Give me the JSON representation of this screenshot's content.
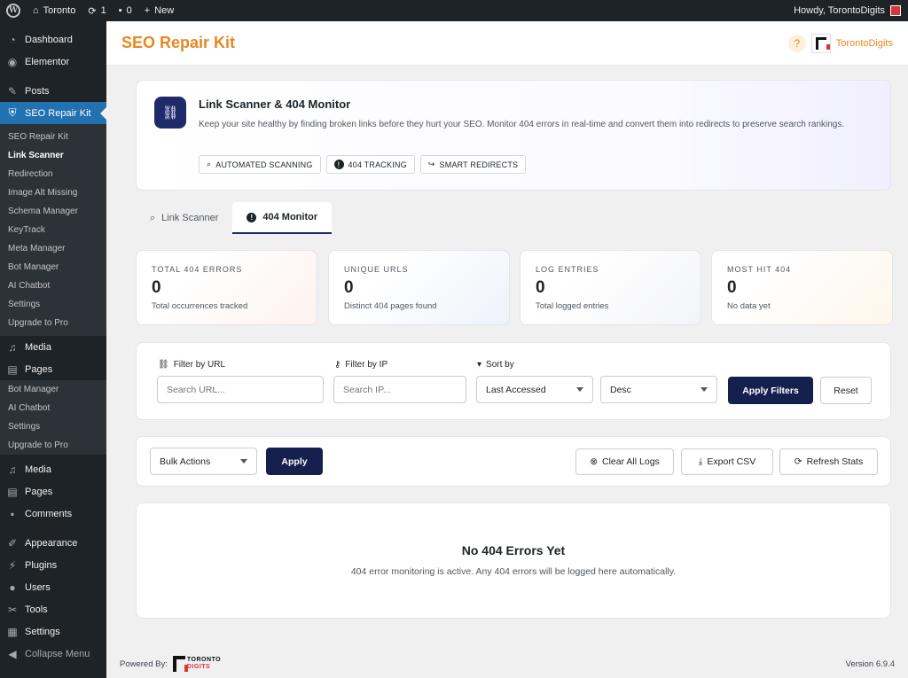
{
  "adminbar": {
    "wp_logo": "W",
    "site_name": "Toronto",
    "updates_count": "1",
    "comments_count": "0",
    "new_label": "New",
    "howdy": "Howdy, TorontoDigits"
  },
  "sidebar": {
    "top_items": [
      {
        "label": "Dashboard",
        "icon": "dashboard-icon"
      },
      {
        "label": "Elementor",
        "icon": "elementor-icon"
      },
      {
        "label": "Posts",
        "icon": "pin-icon"
      },
      {
        "label": "SEO Repair Kit",
        "icon": "shield-icon"
      }
    ],
    "submenu": [
      "SEO Repair Kit",
      "Link Scanner",
      "Redirection",
      "Image Alt Missing",
      "Schema Manager",
      "KeyTrack",
      "Meta Manager",
      "Bot Manager",
      "AI Chatbot",
      "Settings",
      "Upgrade to Pro"
    ],
    "mid_items": [
      {
        "label": "Media",
        "icon": "media-icon"
      },
      {
        "label": "Pages",
        "icon": "pages-icon"
      }
    ],
    "overlay_submenu": [
      "Bot Manager",
      "AI Chatbot",
      "Settings",
      "Upgrade to Pro"
    ],
    "bottom_items": [
      {
        "label": "Media",
        "icon": "media-icon"
      },
      {
        "label": "Pages",
        "icon": "pages-icon"
      },
      {
        "label": "Comments",
        "icon": "comments-icon"
      },
      {
        "label": "Appearance",
        "icon": "appearance-icon"
      },
      {
        "label": "Plugins",
        "icon": "plugins-icon"
      },
      {
        "label": "Users",
        "icon": "users-icon"
      },
      {
        "label": "Tools",
        "icon": "tools-icon"
      },
      {
        "label": "Settings",
        "icon": "settings-icon"
      }
    ],
    "collapse_label": "Collapse Menu"
  },
  "header": {
    "title": "SEO Repair Kit",
    "help": "?",
    "brand": "TorontoDigits"
  },
  "intro": {
    "title": "Link Scanner & 404 Monitor",
    "description": "Keep your site healthy by finding broken links before they hurt your SEO. Monitor 404 errors in real-time and convert them into redirects to preserve search rankings.",
    "chips": [
      "AUTOMATED SCANNING",
      "404 TRACKING",
      "SMART REDIRECTS"
    ]
  },
  "tabs": [
    {
      "label": "Link Scanner",
      "active": false
    },
    {
      "label": "404 Monitor",
      "active": true
    }
  ],
  "stats": [
    {
      "label": "TOTAL 404 ERRORS",
      "value": "0",
      "sub": "Total occurrences tracked"
    },
    {
      "label": "UNIQUE URLS",
      "value": "0",
      "sub": "Distinct 404 pages found"
    },
    {
      "label": "LOG ENTRIES",
      "value": "0",
      "sub": "Total logged entries"
    },
    {
      "label": "MOST HIT 404",
      "value": "0",
      "sub": "No data yet"
    }
  ],
  "filters": {
    "url_label": "Filter by URL",
    "url_placeholder": "Search URL...",
    "ip_label": "Filter by IP",
    "ip_placeholder": "Search IP...",
    "sort_label": "Sort by",
    "sort_value": "Last Accessed",
    "order_value": "Desc",
    "apply_label": "Apply Filters",
    "reset_label": "Reset"
  },
  "actions": {
    "bulk_value": "Bulk Actions",
    "apply_label": "Apply",
    "clear_label": "Clear All Logs",
    "export_label": "Export CSV",
    "refresh_label": "Refresh Stats"
  },
  "empty": {
    "title": "No 404 Errors Yet",
    "description": "404 error monitoring is active. Any 404 errors will be logged here automatically."
  },
  "footer": {
    "powered_by": "Powered By:",
    "logo_line1": "TORONTO",
    "logo_line2": "DIGITS",
    "version": "Version 6.9.4"
  },
  "colors": {
    "accent_orange": "#e8871e",
    "primary_navy": "#16204f",
    "wp_blue": "#2271b1"
  }
}
